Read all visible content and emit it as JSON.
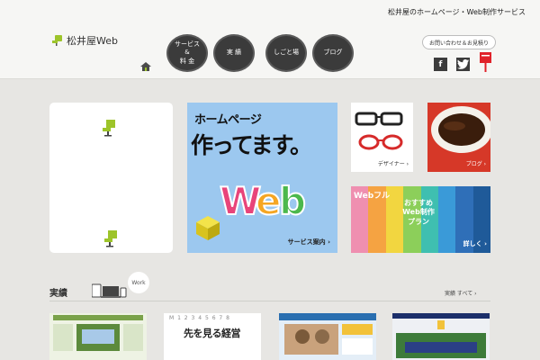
{
  "header": {
    "tagline": "松井屋のホームページ・Web制作サービス",
    "logo_text": "松井屋Web",
    "nav": [
      {
        "label_line1": "サービス",
        "label_line2": "&",
        "label_line3": "料 金"
      },
      {
        "label": "実 績"
      },
      {
        "label": "しごと場"
      },
      {
        "label": "ブログ"
      }
    ],
    "contact_label": "お問い合わせ＆お見積り",
    "facebook_glyph": "f",
    "twitter_glyph": "t"
  },
  "cards": {
    "hp_title1": "ホームページ",
    "hp_title2": "作ってます。",
    "hp_web": "Web",
    "hp_link": "サービス案内 ›",
    "designer_label": "デザイナー ›",
    "blog_label": "ブログ ›",
    "webful_logo": "Webフル",
    "webful_line1": "おすすめ",
    "webful_line2": "Web制作",
    "webful_line3": "プラン",
    "webful_more": "詳しく ›"
  },
  "works": {
    "title": "実績",
    "bubble": "Work",
    "all_link": "実績 すべて ›",
    "thumb2_title": "先を見る経営",
    "thumb2_sub": "M 1 2 3 4 5 6 7 8"
  },
  "colors": {
    "header_bg": "#f6f6f4",
    "page_bg": "#e7e6e3",
    "nav_bg": "#3b3b3b",
    "accent_green": "#9dc42a",
    "blog_red": "#d63828",
    "hp_blue": "#9cc8ef",
    "mail_red": "#e0222a"
  },
  "icons": [
    "home-icon",
    "facebook-icon",
    "twitter-icon",
    "mailbox-icon",
    "chair-icon",
    "glasses-icon",
    "coffee-icon",
    "cube-icon",
    "devices-icon"
  ]
}
